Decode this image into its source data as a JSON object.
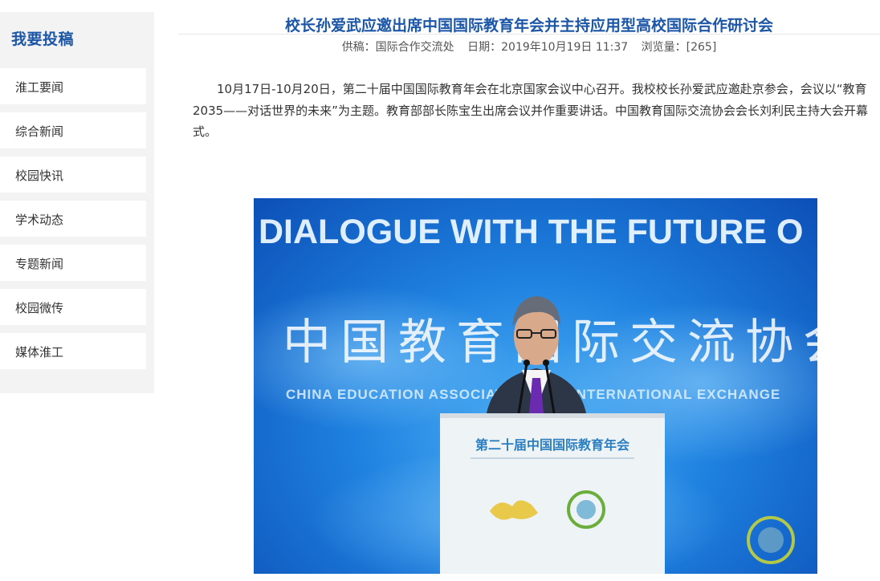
{
  "sidebar": {
    "title": "我要投稿",
    "items": [
      {
        "label": "淮工要闻"
      },
      {
        "label": "综合新闻"
      },
      {
        "label": "校园快讯"
      },
      {
        "label": "学术动态"
      },
      {
        "label": "专题新闻"
      },
      {
        "label": "校园微传"
      },
      {
        "label": "媒体淮工"
      }
    ]
  },
  "article": {
    "title": "校长孙爱武应邀出席中国国际教育年会并主持应用型高校国际合作研讨会",
    "meta": {
      "source": "供稿：国际合作交流处",
      "date": "日期：2019年10月19日 11:37",
      "views": "浏览量：[265]"
    },
    "paragraph": "10月17日-10月20日，第二十届中国国际教育年会在北京国家会议中心召开。我校校长孙爱武应邀赴京参会，会议以“教育2035——对话世界的未来”为主题。教育部部长陈宝生出席会议并作重要讲话。中国教育国际交流协会会长刘利民主持大会开幕式。",
    "photo": {
      "banner_text": "DIALOGUE WITH THE FUTURE O",
      "calligraphy_text": "中国教育国际交流协会",
      "english_line": "CHINA EDUCATION ASSOCIATION FOR INTERNATIONAL EXCHANGE",
      "podium_text": "第二十届中国国际教育年会",
      "colors": {
        "bg_dark": "#0c4fb7",
        "bg_light": "#4fb0f5",
        "podium": "#eef3f6",
        "tie": "#6a2bb0"
      }
    }
  }
}
